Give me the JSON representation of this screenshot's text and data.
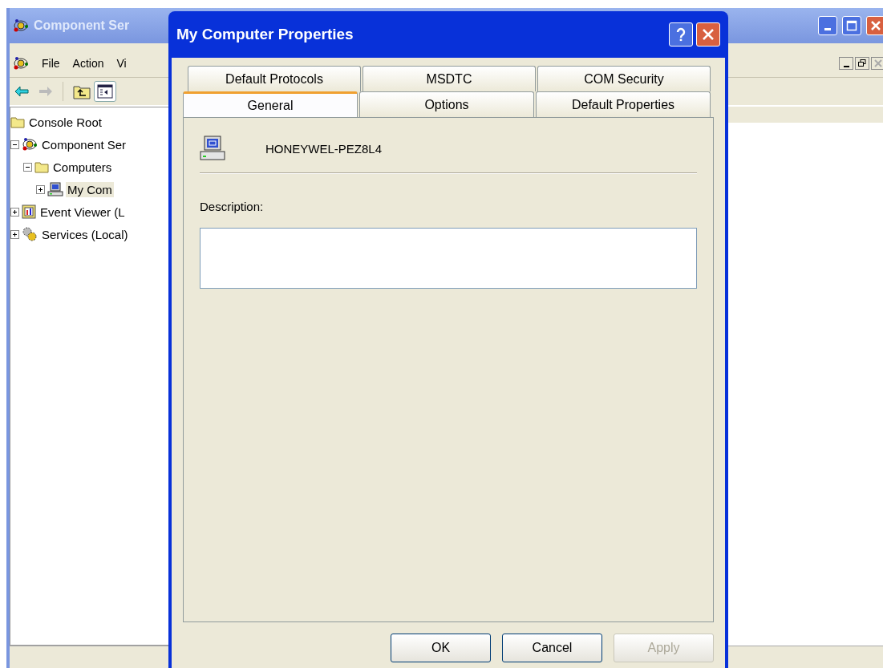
{
  "main_window": {
    "title": "Component Ser",
    "menu": [
      "File",
      "Action",
      "Vi"
    ],
    "tree": [
      {
        "label": "Console Root",
        "kind": "folder",
        "selected": false,
        "children": [
          {
            "label": "Component Ser",
            "kind": "component",
            "expanded": true,
            "selected": false,
            "children": [
              {
                "label": "Computers",
                "kind": "folder",
                "expanded": true,
                "selected": false,
                "children": [
                  {
                    "label": "My Com",
                    "kind": "computer",
                    "expanded": false,
                    "selected": true
                  }
                ]
              }
            ]
          },
          {
            "label": "Event Viewer (L",
            "kind": "eventlog",
            "expanded": false,
            "selected": false
          },
          {
            "label": "Services (Local)",
            "kind": "services",
            "expanded": false,
            "selected": false
          }
        ]
      }
    ]
  },
  "dialog": {
    "title": "My Computer Properties",
    "tab_rows": [
      {
        "tabs": [
          {
            "label": "Default Protocols",
            "selected": false
          },
          {
            "label": "MSDTC",
            "selected": false
          },
          {
            "label": "COM Security",
            "selected": false
          }
        ]
      },
      {
        "tabs": [
          {
            "label": "General",
            "selected": true
          },
          {
            "label": "Options",
            "selected": false
          },
          {
            "label": "Default Properties",
            "selected": false
          }
        ]
      }
    ],
    "computer_name": "HONEYWEL-PEZ8L4",
    "description_label": "Description:",
    "buttons": [
      {
        "label": "OK",
        "disabled": false
      },
      {
        "label": "Cancel",
        "disabled": false
      },
      {
        "label": "Apply",
        "disabled": true
      }
    ]
  }
}
